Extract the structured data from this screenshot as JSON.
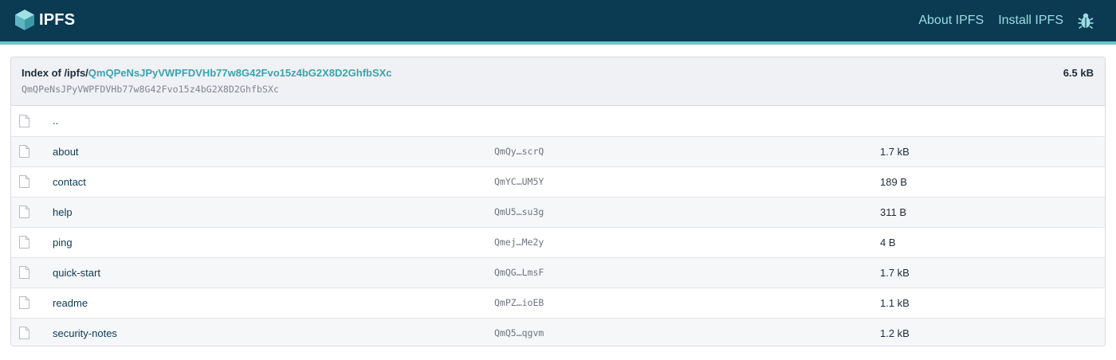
{
  "header": {
    "brand": "IPFS",
    "logo_icon": "ipfs-cube-icon",
    "nav": [
      {
        "label": "About IPFS"
      },
      {
        "label": "Install IPFS"
      }
    ],
    "bug_icon": "bug-icon"
  },
  "directory": {
    "index_prefix": "Index of /ipfs/",
    "cid": "QmQPeNsJPyVWPFDVHb77w8G42Fvo15z4bG2X8D2GhfbSXc",
    "cid_sub": "QmQPeNsJPyVWPFDVHb77w8G42Fvo15z4bG2X8D2GhfbSXc",
    "total_size": "6.5 kB",
    "parent": "..",
    "file_icon": "file-icon",
    "entries": [
      {
        "name": "about",
        "hash": "QmQy…scrQ",
        "size": "1.7 kB"
      },
      {
        "name": "contact",
        "hash": "QmYC…UM5Y",
        "size": "189 B"
      },
      {
        "name": "help",
        "hash": "QmU5…su3g",
        "size": "311 B"
      },
      {
        "name": "ping",
        "hash": "Qmej…Me2y",
        "size": "4 B"
      },
      {
        "name": "quick-start",
        "hash": "QmQG…LmsF",
        "size": "1.7 kB"
      },
      {
        "name": "readme",
        "hash": "QmPZ…ioEB",
        "size": "1.1 kB"
      },
      {
        "name": "security-notes",
        "hash": "QmQ5…qgvm",
        "size": "1.2 kB"
      }
    ]
  },
  "colors": {
    "topbar": "#0b3a53",
    "accent": "#69c4cd",
    "link": "#39a3b0"
  }
}
